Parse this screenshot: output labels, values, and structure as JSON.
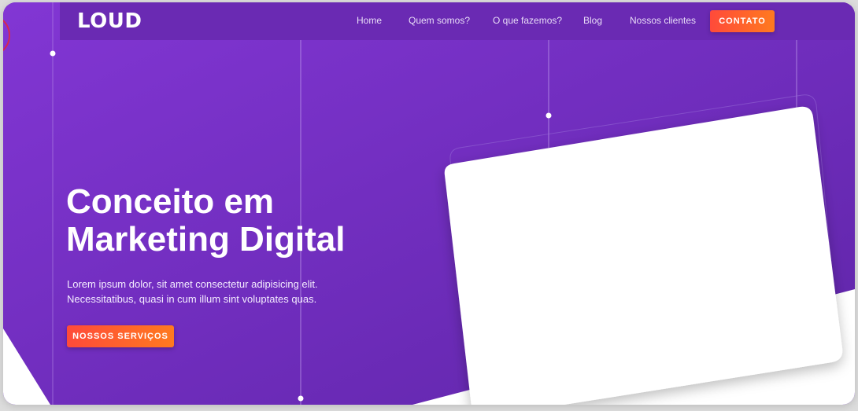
{
  "brand": {
    "logo": "LOUD"
  },
  "nav": {
    "items": [
      {
        "label": "Home"
      },
      {
        "label": "Quem somos?"
      },
      {
        "label": "O que fazemos?"
      },
      {
        "label": "Blog"
      },
      {
        "label": "Nossos clientes"
      }
    ],
    "cta_label": "CONTATO"
  },
  "hero": {
    "title_line1": "Conceito em",
    "title_line2": "Marketing Digital",
    "subtitle_line1": "Lorem ipsum dolor, sit amet consectetur adipisicing elit.",
    "subtitle_line2": "Necessitatibus, quasi in cum illum sint voluptates quas.",
    "button_label": "NOSSOS SERVIÇOS"
  },
  "colors": {
    "background": "#7633c6",
    "navbar": "#6a2ab3",
    "accent_start": "#ff4a3a",
    "accent_end": "#ff7a1f"
  }
}
